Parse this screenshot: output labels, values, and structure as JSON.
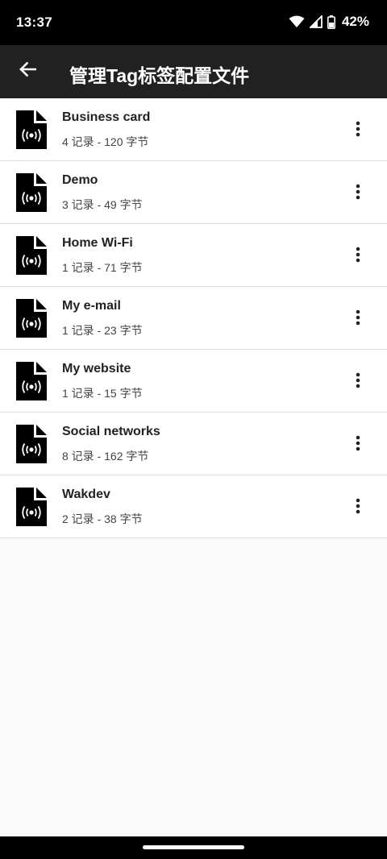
{
  "status_bar": {
    "time": "13:37",
    "battery_percent": "42%",
    "icons": [
      "wifi-icon",
      "cell-signal-icon",
      "battery-icon"
    ]
  },
  "app_bar": {
    "title": "管理Tag标签配置文件",
    "back_icon": "arrow-left-icon"
  },
  "files": [
    {
      "name": "Business card",
      "meta": "4 记录 - 120 字节"
    },
    {
      "name": "Demo",
      "meta": "3 记录 - 49 字节"
    },
    {
      "name": "Home Wi-Fi",
      "meta": "1 记录 - 71 字节"
    },
    {
      "name": "My e-mail",
      "meta": "1 记录 - 23 字节"
    },
    {
      "name": "My website",
      "meta": "1 记录 - 15 字节"
    },
    {
      "name": "Social networks",
      "meta": "8 记录 - 162 字节"
    },
    {
      "name": "Wakdev",
      "meta": "2 记录 - 38 字节"
    }
  ],
  "colors": {
    "status_bar": "#000000",
    "app_bar": "#212121",
    "list_background": "#ffffff",
    "page_background": "#fafafa",
    "divider": "#dcdcdc"
  }
}
